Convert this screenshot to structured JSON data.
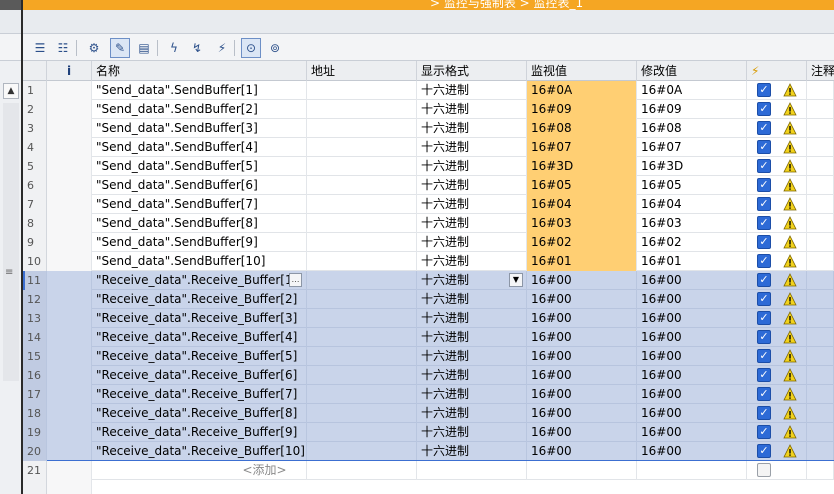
{
  "window": {
    "title_fragment": "> 监控与强制表 > 监控表_1"
  },
  "toolbar": {
    "buttons": [
      {
        "name": "insert-row-icon",
        "glyph": "☰"
      },
      {
        "name": "add-row-icon",
        "glyph": "☷"
      },
      {
        "name": "modify-now-icon",
        "glyph": "⚙"
      },
      {
        "name": "show-modify-column-icon",
        "glyph": "✎"
      },
      {
        "name": "show-extended-mode-icon",
        "glyph": "▤"
      },
      {
        "name": "modify-once-icon",
        "glyph": "ϟ"
      },
      {
        "name": "modify-trigger-icon",
        "glyph": "↯"
      },
      {
        "name": "force-icon",
        "glyph": "⚡"
      },
      {
        "name": "monitor-all-icon",
        "glyph": "⊙"
      },
      {
        "name": "monitor-once-icon",
        "glyph": "⊚"
      }
    ]
  },
  "table": {
    "headers": {
      "info": "i",
      "name": "名称",
      "address": "地址",
      "format": "显示格式",
      "monitor": "监视值",
      "modify": "修改值",
      "modify_flag": "⚡",
      "comment": "注释"
    },
    "rows": [
      {
        "no": "1",
        "name": "\"Send_data\".SendBuffer[1]",
        "format": "十六进制",
        "monitor": "16#0A",
        "modify": "16#0A"
      },
      {
        "no": "2",
        "name": "\"Send_data\".SendBuffer[2]",
        "format": "十六进制",
        "monitor": "16#09",
        "modify": "16#09"
      },
      {
        "no": "3",
        "name": "\"Send_data\".SendBuffer[3]",
        "format": "十六进制",
        "monitor": "16#08",
        "modify": "16#08"
      },
      {
        "no": "4",
        "name": "\"Send_data\".SendBuffer[4]",
        "format": "十六进制",
        "monitor": "16#07",
        "modify": "16#07"
      },
      {
        "no": "5",
        "name": "\"Send_data\".SendBuffer[5]",
        "format": "十六进制",
        "monitor": "16#3D",
        "modify": "16#3D"
      },
      {
        "no": "6",
        "name": "\"Send_data\".SendBuffer[6]",
        "format": "十六进制",
        "monitor": "16#05",
        "modify": "16#05"
      },
      {
        "no": "7",
        "name": "\"Send_data\".SendBuffer[7]",
        "format": "十六进制",
        "monitor": "16#04",
        "modify": "16#04"
      },
      {
        "no": "8",
        "name": "\"Send_data\".SendBuffer[8]",
        "format": "十六进制",
        "monitor": "16#03",
        "modify": "16#03"
      },
      {
        "no": "9",
        "name": "\"Send_data\".SendBuffer[9]",
        "format": "十六进制",
        "monitor": "16#02",
        "modify": "16#02"
      },
      {
        "no": "10",
        "name": "\"Send_data\".SendBuffer[10]",
        "format": "十六进制",
        "monitor": "16#01",
        "modify": "16#01"
      },
      {
        "no": "11",
        "name": "\"Receive_data\".Receive_Buffer[1]",
        "format": "十六进制",
        "monitor": "16#00",
        "modify": "16#00"
      },
      {
        "no": "12",
        "name": "\"Receive_data\".Receive_Buffer[2]",
        "format": "十六进制",
        "monitor": "16#00",
        "modify": "16#00"
      },
      {
        "no": "13",
        "name": "\"Receive_data\".Receive_Buffer[3]",
        "format": "十六进制",
        "monitor": "16#00",
        "modify": "16#00"
      },
      {
        "no": "14",
        "name": "\"Receive_data\".Receive_Buffer[4]",
        "format": "十六进制",
        "monitor": "16#00",
        "modify": "16#00"
      },
      {
        "no": "15",
        "name": "\"Receive_data\".Receive_Buffer[5]",
        "format": "十六进制",
        "monitor": "16#00",
        "modify": "16#00"
      },
      {
        "no": "16",
        "name": "\"Receive_data\".Receive_Buffer[6]",
        "format": "十六进制",
        "monitor": "16#00",
        "modify": "16#00"
      },
      {
        "no": "17",
        "name": "\"Receive_data\".Receive_Buffer[7]",
        "format": "十六进制",
        "monitor": "16#00",
        "modify": "16#00"
      },
      {
        "no": "18",
        "name": "\"Receive_data\".Receive_Buffer[8]",
        "format": "十六进制",
        "monitor": "16#00",
        "modify": "16#00"
      },
      {
        "no": "19",
        "name": "\"Receive_data\".Receive_Buffer[9]",
        "format": "十六进制",
        "monitor": "16#00",
        "modify": "16#00"
      },
      {
        "no": "20",
        "name": "\"Receive_data\".Receive_Buffer[10]",
        "format": "十六进制",
        "monitor": "16#00",
        "modify": "16#00"
      }
    ],
    "add_row": {
      "no": "21",
      "label": "<添加>"
    }
  },
  "colors": {
    "title_orange": "#f5a623",
    "monitor_highlight": "#ffcf73",
    "selection": "#c9d4ea",
    "checkbox": "#2d6ad6",
    "warning": "#f2d21b"
  },
  "icons": {
    "checkbox_checked": "✓",
    "dropdown": "▼",
    "edit": "…",
    "scroll_up": "▲",
    "grip": "≡"
  }
}
